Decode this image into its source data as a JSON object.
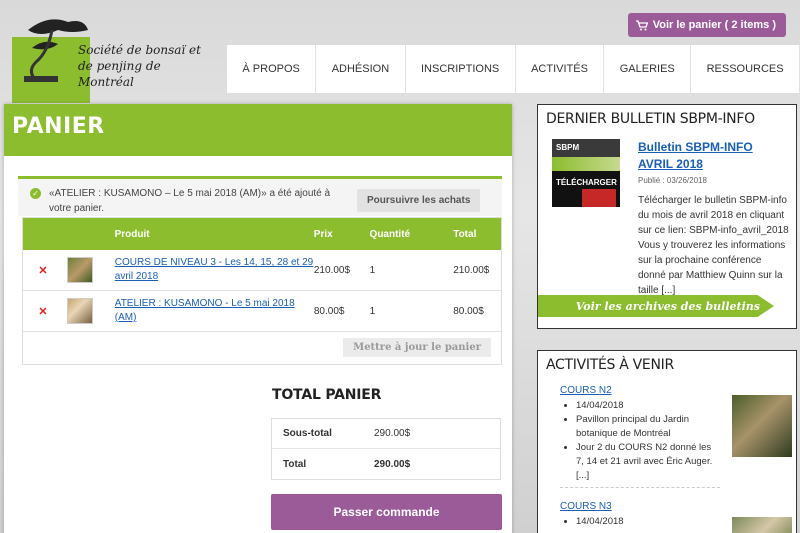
{
  "header": {
    "logo_text": "Société de bonsaï et de penjing de Montréal",
    "cart_button": "Voir le panier ( 2 items )",
    "nav": [
      "À PROPOS",
      "ADHÉSION",
      "INSCRIPTIONS",
      "ACTIVITÉS",
      "GALERIES",
      "RESSOURCES"
    ]
  },
  "cart": {
    "title": "PANIER",
    "notice": "«ATELIER : KUSAMONO – Le 5 mai 2018 (AM)» a été ajouté à votre panier.",
    "continue_label": "Poursuivre les achats",
    "columns": {
      "product": "Produit",
      "price": "Prix",
      "qty": "Quantité",
      "total": "Total"
    },
    "items": [
      {
        "remove": "✕",
        "name": "COURS DE NIVEAU 3 - Les 14, 15, 28 et 29 avril 2018",
        "price": "210.00$",
        "qty": "1",
        "total": "210.00$"
      },
      {
        "remove": "✕",
        "name": "ATELIER : KUSAMONO - Le 5 mai 2018 (AM)",
        "price": "80.00$",
        "qty": "1",
        "total": "80.00$"
      }
    ],
    "update_label": "Mettre à jour le panier",
    "total_heading": "TOTAL PANIER",
    "subtotal_label": "Sous-total",
    "subtotal_value": "290.00$",
    "total_label": "Total",
    "total_value": "290.00$",
    "checkout_label": "Passer commande"
  },
  "bulletin": {
    "title": "DERNIER BULLETIN SBPM-INFO",
    "thumb_top": "SBPM",
    "thumb_bottom": "TÉLÉCHARGER",
    "link": "Bulletin SBPM-INFO AVRIL 2018",
    "date": "Publié : 03/26/2018",
    "text": "Télécharger le bulletin SBPM-info du mois de avril 2018 en cliquant sur ce lien: SBPM-info_avril_2018 Vous y trouverez les informations sur la prochaine conférence donné par Matthiew Quinn sur la taille [...]",
    "archive_label": "Voir les archives des bulletins"
  },
  "activities": {
    "title": "ACTIVITÉS À VENIR",
    "items": [
      {
        "link": "COURS N2",
        "bullets": [
          "14/04/2018",
          "Pavillon principal du Jardin botanique de Montréal",
          "Jour 2 du COURS N2 donné les 7, 14 et 21 avril avec Éric Auger. [...]"
        ]
      },
      {
        "link": "COURS N3",
        "bullets": [
          "14/04/2018"
        ]
      }
    ]
  },
  "colors": {
    "accent_green": "#8cbd2f",
    "accent_purple": "#9b5b99"
  }
}
